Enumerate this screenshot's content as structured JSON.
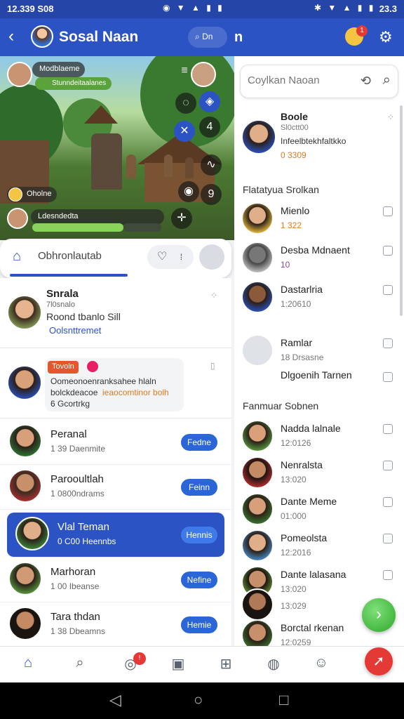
{
  "status": {
    "left_time": "12.339 S08",
    "right_time": "23.3"
  },
  "left_header": {
    "title": "Sosal Naan",
    "search_label": "Dn"
  },
  "right_header": {
    "partial_title": "n",
    "badge": "1"
  },
  "game": {
    "player_tag": "Modblaeme",
    "player_sub": "Stunndeitaalanes",
    "chip_bottom": "Oholne",
    "bar_label": "Ldesndedta",
    "icons": [
      "menu-icon",
      "map-icon",
      "four-icon",
      "cross-icon",
      "nine-icon",
      "crosshair-icon"
    ]
  },
  "tabcard": {
    "label": "Obhronlautab"
  },
  "feed": {
    "post1": {
      "name": "Snrala",
      "sub": "7l0snalo",
      "line": "Roond tbanlo Sill",
      "link": "Oolsnttremet"
    },
    "post2": {
      "chip": "Tovoln",
      "text1": "Oomeonoenranksahee hlaln",
      "text2": "bolckdeacoe",
      "text3": "ieaocomtinor bolh",
      "foot": "6 Gcortrkg"
    }
  },
  "chats": [
    {
      "name": "Peranal",
      "sub": "1 39 Daenmite",
      "btn": "Fedne"
    },
    {
      "name": "Parooultlah",
      "sub": "1 0800ndrams",
      "btn": "Feinn"
    },
    {
      "name": "Vlal Teman",
      "sub": "0 C00 Heennbs",
      "btn": "Hennis"
    },
    {
      "name": "Marhoran",
      "sub": "1 00 Ibeanse",
      "btn": "Nefine"
    },
    {
      "name": "Tara thdan",
      "sub": "1 38 Dbeamns",
      "btn": "Hemie"
    }
  ],
  "right_panel": {
    "search_placeholder": "Coylkan Naoan",
    "top": {
      "name": "Boole",
      "sub1": "Sl0ctt00",
      "sub2": "Infeelbtekhfaltkko",
      "score": "0 3309"
    },
    "section1": "Flatatyua Srolkan",
    "list1": [
      {
        "name": "Mienlo",
        "sub": "1 322"
      },
      {
        "name": "Desba Mdnaent",
        "sub": "10"
      },
      {
        "name": "Dastarlria",
        "sub": "1:20610"
      },
      {
        "name": "Ramlar",
        "sub": "18 Drsasne"
      },
      {
        "name": "Dlgoenih Tarnen",
        "sub": ""
      }
    ],
    "section2": "Fanmuar Sobnen",
    "list2": [
      {
        "name": "Nadda lalnale",
        "sub": "12:0126"
      },
      {
        "name": "Nenralsta",
        "sub": "13:020"
      },
      {
        "name": "Dante Meme",
        "sub": "01:000"
      },
      {
        "name": "Pomeolsta",
        "sub": "12:2016"
      },
      {
        "name": "Dante lalasana",
        "sub": "13:020"
      },
      {
        "name": "",
        "sub": "13:029"
      },
      {
        "name": "Borctal rkenan",
        "sub": "12:0259"
      }
    ]
  },
  "colors": {
    "primary": "#2b53c4",
    "accent_red": "#e53935",
    "accent_green": "#2fa82a"
  }
}
